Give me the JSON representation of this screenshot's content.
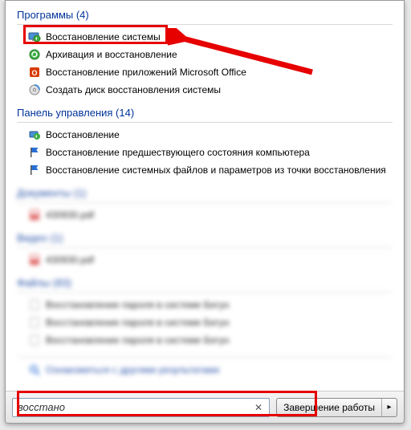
{
  "sections": {
    "programs": {
      "header": "Программы (4)",
      "items": [
        {
          "label": "Восстановление системы",
          "icon": "monitor-restore-icon"
        },
        {
          "label": "Архивация и восстановление",
          "icon": "backup-icon"
        },
        {
          "label": "Восстановление приложений Microsoft Office",
          "icon": "office-restore-icon"
        },
        {
          "label": "Создать диск восстановления системы",
          "icon": "disc-icon"
        }
      ]
    },
    "control_panel": {
      "header": "Панель управления (14)",
      "items": [
        {
          "label": "Восстановление",
          "icon": "restore-icon"
        },
        {
          "label": "Восстановление предшествующего состояния компьютера",
          "icon": "flag-icon"
        },
        {
          "label": "Восстановление системных файлов и параметров из точки восстановления",
          "icon": "flag-icon"
        }
      ]
    },
    "documents": {
      "header": "Документы (1)",
      "items": [
        {
          "label": "430930.pdf",
          "icon": "pdf-icon"
        }
      ]
    },
    "video": {
      "header": "Видео (1)",
      "items": [
        {
          "label": "430930.pdf",
          "icon": "pdf-icon"
        }
      ]
    },
    "files": {
      "header": "Файлы (83)",
      "items": [
        {
          "label": "Восстановление пароля в системе Бегун",
          "icon": "file-icon"
        },
        {
          "label": "Восстановление пароля в системе Бегун",
          "icon": "file-icon"
        },
        {
          "label": "Восстановление пароля в системе Бегун",
          "icon": "file-icon"
        }
      ]
    },
    "more": {
      "label": "Ознакомиться с другими результатами"
    }
  },
  "search": {
    "value": "восстано"
  },
  "shutdown": {
    "label": "Завершение работы"
  },
  "annotation": {
    "arrow_color": "#e60000"
  }
}
